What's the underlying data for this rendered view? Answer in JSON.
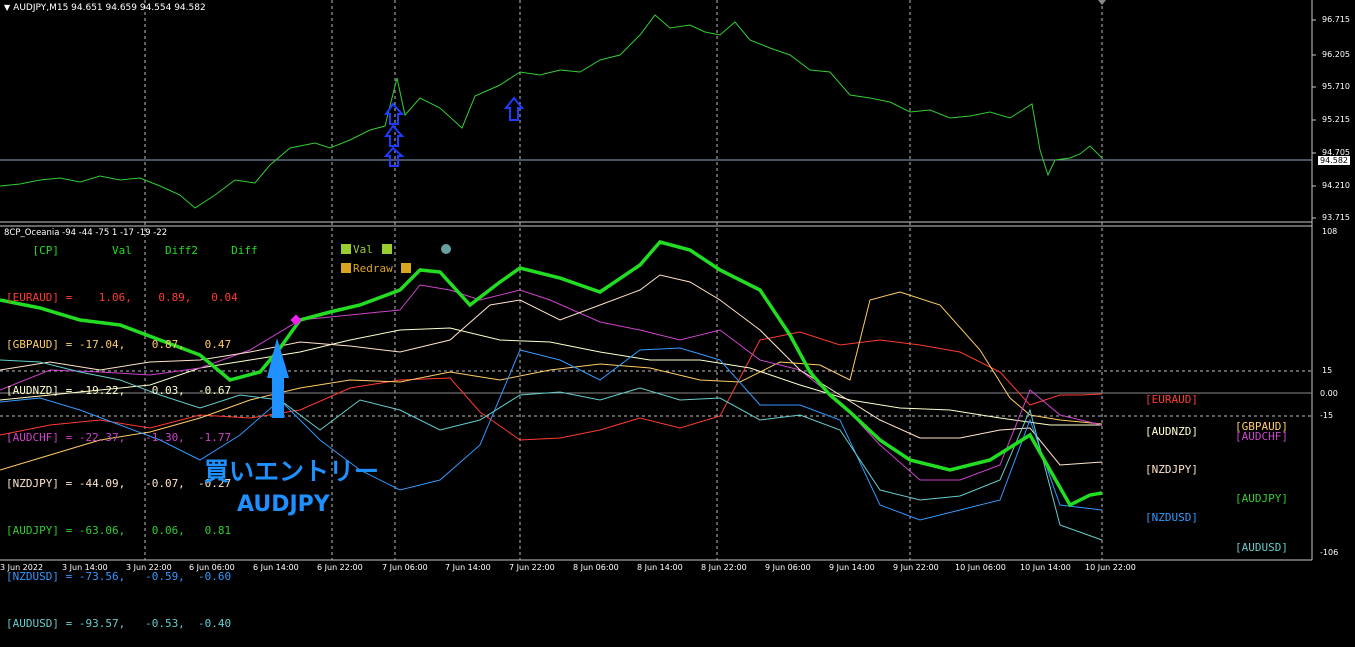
{
  "top_chart": {
    "title": "AUDJPY,M15  94.651 94.659 94.554 94.582",
    "price_axis": [
      "96.715",
      "96.205",
      "95.710",
      "95.215",
      "94.705",
      "94.210",
      "93.715"
    ],
    "current_price": "94.582",
    "line_color": "#32cd32"
  },
  "indicator": {
    "title": "8CP_Oceania -94 -44 -75 1 -17 -19 -22",
    "header": "    [CP]        Val     Diff2     Diff",
    "rows": [
      {
        "text": "[EURAUD] =    1.06,    0.89,   0.04",
        "color": "#ff3b30"
      },
      {
        "text": "[GBPAUD] = -17.04,    0.87,   0.47",
        "color": "#ffcc66"
      },
      {
        "text": "[AUDNZD] = -19.22,    0.03,  -0.67",
        "color": "#ffffcc"
      },
      {
        "text": "[AUDCHF] = -22.37,   -1.30,  -1.77",
        "color": "#cc44cc"
      },
      {
        "text": "[NZDJPY] = -44.09,   -0.07,  -0.27",
        "color": "#ffe4cc"
      },
      {
        "text": "[AUDJPY] = -63.06,    0.06,   0.81",
        "color": "#33cc33"
      },
      {
        "text": "[NZDUSD] = -73.56,   -0.59,  -0.60",
        "color": "#3399ff"
      },
      {
        "text": "[AUDUSD] = -93.57,   -0.53,  -0.40",
        "color": "#66cccc"
      }
    ],
    "legend_val": "Val",
    "legend_redraw": "Redraw",
    "axis": [
      "108",
      "15",
      "0.00",
      "-15",
      "-106"
    ],
    "right_labels": [
      {
        "text": "[EURAUD]",
        "color": "#ff3b30"
      },
      {
        "text": "[GBPAUD]",
        "color": "#ffcc66"
      },
      {
        "text": "[AUDNZD]",
        "color": "#ffffcc"
      },
      {
        "text": "[AUDCHF]",
        "color": "#cc44cc"
      },
      {
        "text": "[NZDJPY]",
        "color": "#ffe4cc"
      },
      {
        "text": "[AUDJPY]",
        "color": "#33cc33"
      },
      {
        "text": "[NZDUSD]",
        "color": "#3399ff"
      },
      {
        "text": "[AUDUSD]",
        "color": "#66cccc"
      }
    ]
  },
  "annotation": {
    "entry_line1": "買いエントリー",
    "entry_line2": "AUDJPY",
    "color": "#1e90ff"
  },
  "time_axis": [
    "3 Jun 2022",
    "3 Jun 14:00",
    "3 Jun 22:00",
    "6 Jun 06:00",
    "6 Jun 14:00",
    "6 Jun 22:00",
    "7 Jun 06:00",
    "7 Jun 14:00",
    "7 Jun 22:00",
    "8 Jun 06:00",
    "8 Jun 14:00",
    "8 Jun 22:00",
    "9 Jun 06:00",
    "9 Jun 14:00",
    "9 Jun 22:00",
    "10 Jun 06:00",
    "10 Jun 14:00",
    "10 Jun 22:00"
  ]
}
